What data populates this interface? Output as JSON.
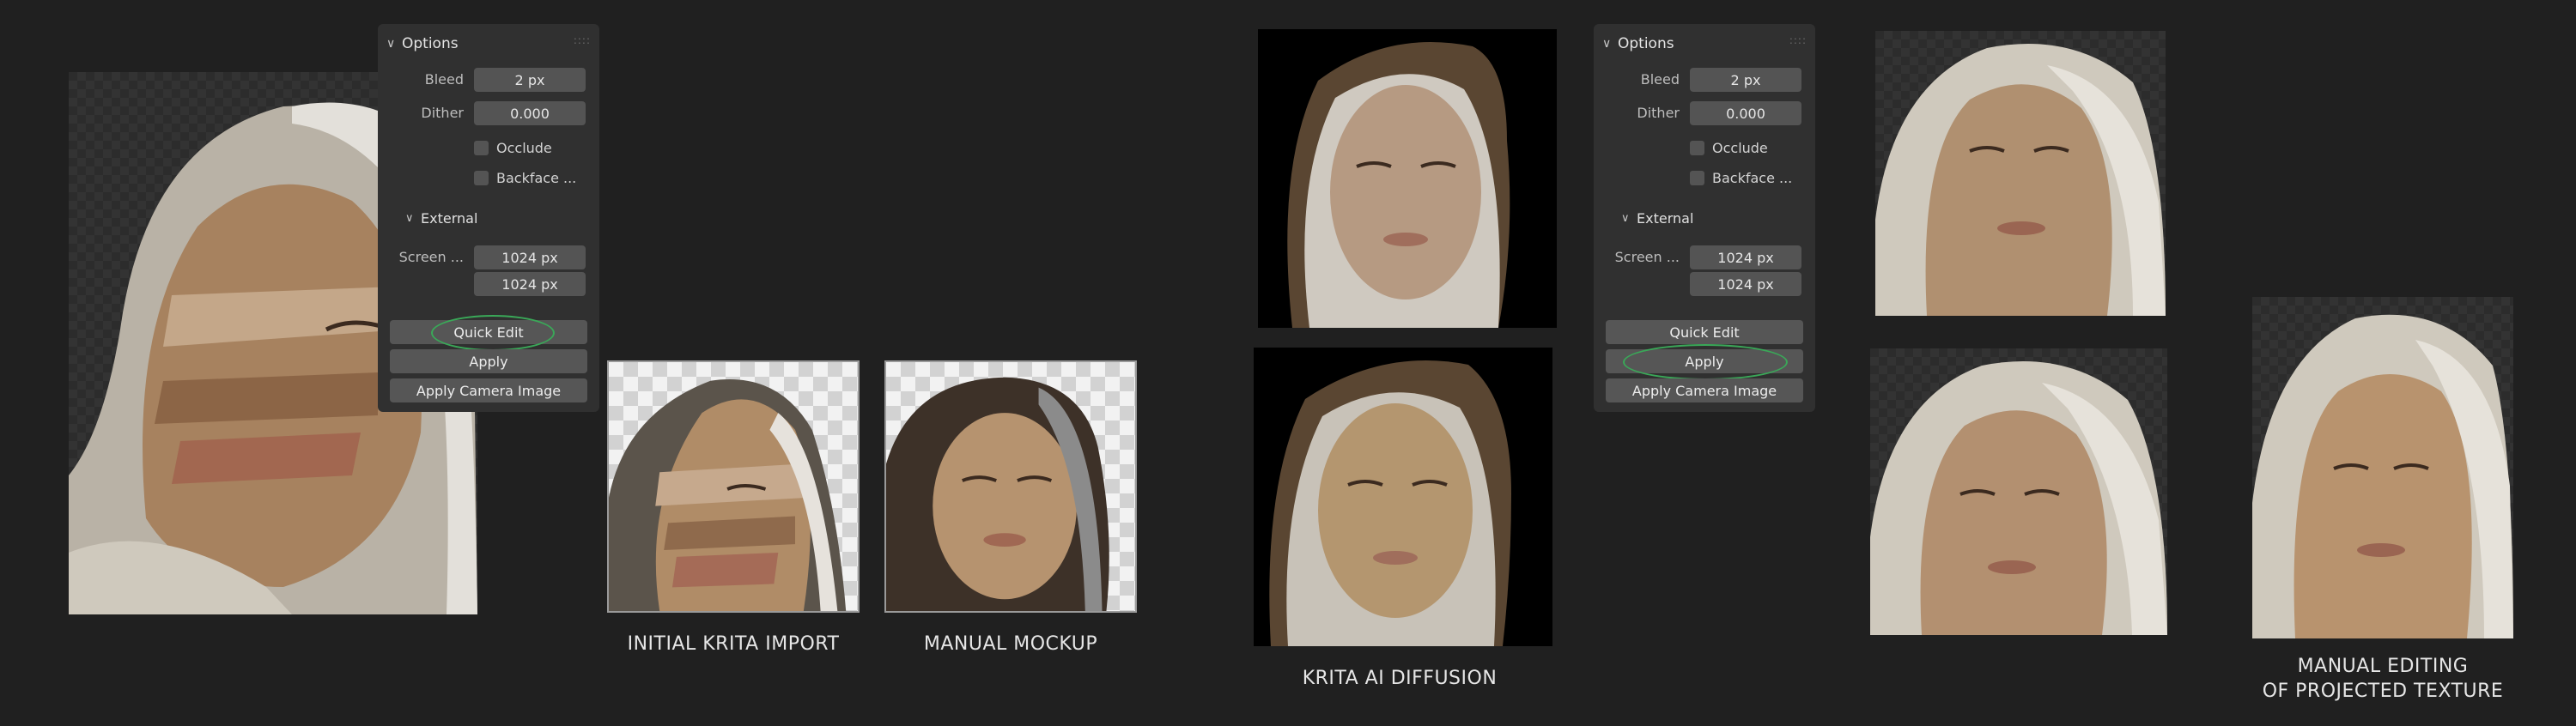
{
  "panels": [
    {
      "options_label": "Options",
      "bleed_label": "Bleed",
      "bleed_value": "2 px",
      "dither_label": "Dither",
      "dither_value": "0.000",
      "occlude_label": "Occlude",
      "backface_label": "Backface ...",
      "external_label": "External",
      "screen_label": "Screen ...",
      "screen_width": "1024 px",
      "screen_height": "1024 px",
      "quick_edit_label": "Quick Edit",
      "apply_label": "Apply",
      "apply_camera_label": "Apply Camera Image",
      "highlighted": "Quick Edit"
    },
    {
      "options_label": "Options",
      "bleed_label": "Bleed",
      "bleed_value": "2 px",
      "dither_label": "Dither",
      "dither_value": "0.000",
      "occlude_label": "Occlude",
      "backface_label": "Backface ...",
      "external_label": "External",
      "screen_label": "Screen ...",
      "screen_width": "1024 px",
      "screen_height": "1024 px",
      "quick_edit_label": "Quick Edit",
      "apply_label": "Apply",
      "apply_camera_label": "Apply Camera Image",
      "highlighted": "Apply"
    }
  ],
  "captions": {
    "initial": "INITIAL KRITA IMPORT",
    "mockup": "MANUAL MOCKUP",
    "diffusion": "KRITA AI DIFFUSION",
    "editing_line1": "MANUAL EDITING",
    "editing_line2": "OF PROJECTED TEXTURE"
  },
  "colors": {
    "background": "#202020",
    "panel": "#303030",
    "field": "#545454",
    "highlight_ring": "#3aa858"
  }
}
